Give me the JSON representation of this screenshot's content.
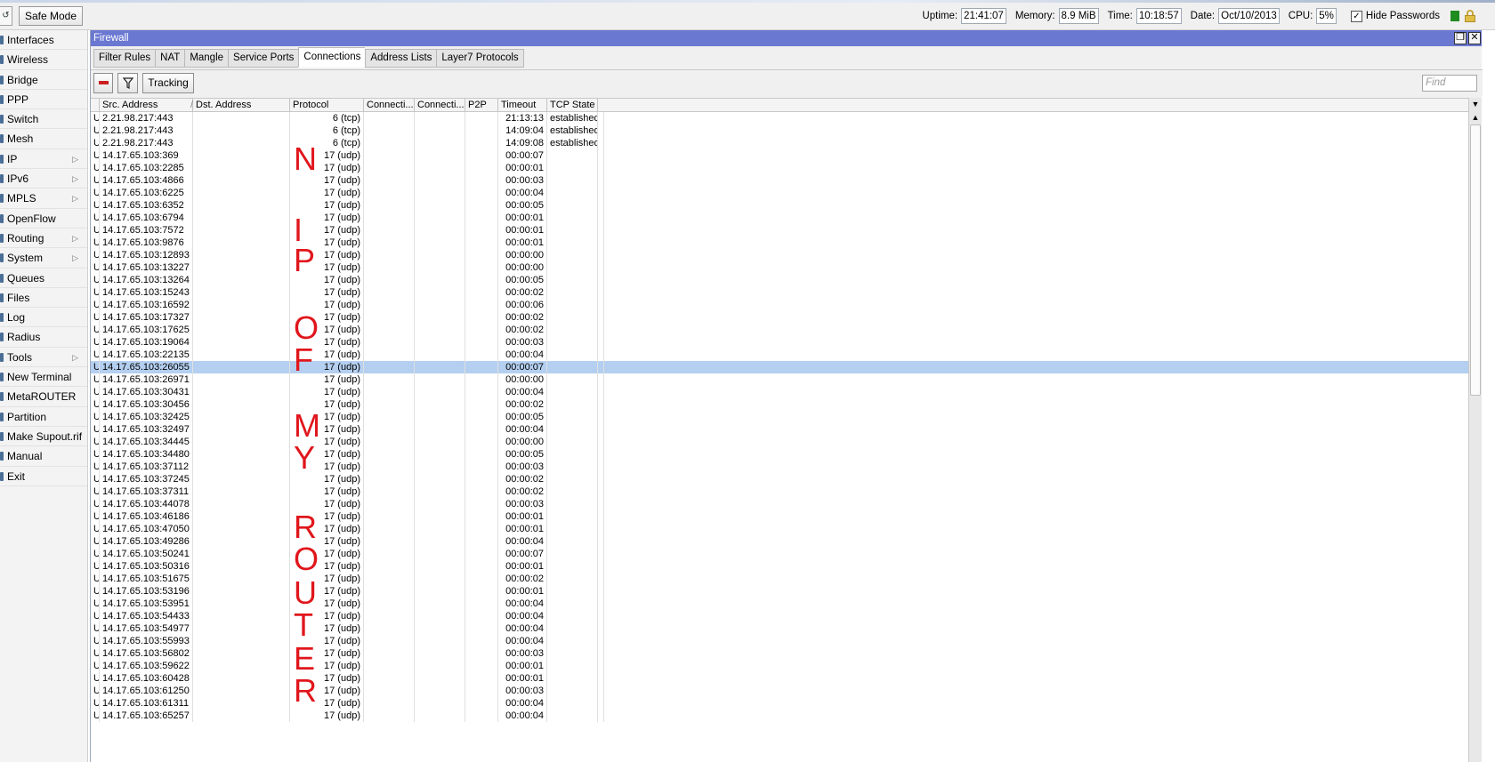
{
  "topbar": {
    "safe_mode_label": "Safe Mode",
    "uptime_label": "Uptime:",
    "uptime": "21:41:07",
    "memory_label": "Memory:",
    "memory": "8.9 MiB",
    "time_label": "Time:",
    "time": "10:18:57",
    "date_label": "Date:",
    "date": "Oct/10/2013",
    "cpu_label": "CPU:",
    "cpu": "5%",
    "hide_passwords_label": "Hide Passwords",
    "hide_passwords_checked": true
  },
  "sidebar": {
    "items": [
      {
        "label": "Interfaces",
        "submenu": false
      },
      {
        "label": "Wireless",
        "submenu": false
      },
      {
        "label": "Bridge",
        "submenu": false
      },
      {
        "label": "PPP",
        "submenu": false
      },
      {
        "label": "Switch",
        "submenu": false
      },
      {
        "label": "Mesh",
        "submenu": false
      },
      {
        "label": "IP",
        "submenu": true
      },
      {
        "label": "IPv6",
        "submenu": true
      },
      {
        "label": "MPLS",
        "submenu": true
      },
      {
        "label": "OpenFlow",
        "submenu": false
      },
      {
        "label": "Routing",
        "submenu": true
      },
      {
        "label": "System",
        "submenu": true
      },
      {
        "label": "Queues",
        "submenu": false
      },
      {
        "label": "Files",
        "submenu": false
      },
      {
        "label": "Log",
        "submenu": false
      },
      {
        "label": "Radius",
        "submenu": false
      },
      {
        "label": "Tools",
        "submenu": true
      },
      {
        "label": "New Terminal",
        "submenu": false
      },
      {
        "label": "MetaROUTER",
        "submenu": false
      },
      {
        "label": "Partition",
        "submenu": false
      },
      {
        "label": "Make Supout.rif",
        "submenu": false
      },
      {
        "label": "Manual",
        "submenu": false
      },
      {
        "label": "Exit",
        "submenu": false
      }
    ]
  },
  "window": {
    "title": "Firewall",
    "tabs": [
      "Filter Rules",
      "NAT",
      "Mangle",
      "Service Ports",
      "Connections",
      "Address Lists",
      "Layer7 Protocols"
    ],
    "active_tab": "Connections",
    "tracking_label": "Tracking",
    "find_placeholder": "Find"
  },
  "table": {
    "columns": [
      "",
      "Src. Address",
      "Dst. Address",
      "Protocol",
      "Connecti...",
      "Connecti...",
      "P2P",
      "Timeout",
      "TCP State"
    ],
    "sort_indicator": "/",
    "selected_row": 20,
    "rows": [
      [
        "U",
        "2.21.98.217:443",
        "",
        "6 (tcp)",
        "",
        "",
        "",
        "21:13:13",
        "established"
      ],
      [
        "U",
        "2.21.98.217:443",
        "",
        "6 (tcp)",
        "",
        "",
        "",
        "14:09:04",
        "established"
      ],
      [
        "U",
        "2.21.98.217:443",
        "",
        "6 (tcp)",
        "",
        "",
        "",
        "14:09:08",
        "established"
      ],
      [
        "U",
        "14.17.65.103:369",
        "",
        "17 (udp)",
        "",
        "",
        "",
        "00:00:07",
        ""
      ],
      [
        "U",
        "14.17.65.103:2285",
        "",
        "17 (udp)",
        "",
        "",
        "",
        "00:00:01",
        ""
      ],
      [
        "U",
        "14.17.65.103:4866",
        "",
        "17 (udp)",
        "",
        "",
        "",
        "00:00:03",
        ""
      ],
      [
        "U",
        "14.17.65.103:6225",
        "",
        "17 (udp)",
        "",
        "",
        "",
        "00:00:04",
        ""
      ],
      [
        "U",
        "14.17.65.103:6352",
        "",
        "17 (udp)",
        "",
        "",
        "",
        "00:00:05",
        ""
      ],
      [
        "U",
        "14.17.65.103:6794",
        "",
        "17 (udp)",
        "",
        "",
        "",
        "00:00:01",
        ""
      ],
      [
        "U",
        "14.17.65.103:7572",
        "",
        "17 (udp)",
        "",
        "",
        "",
        "00:00:01",
        ""
      ],
      [
        "U",
        "14.17.65.103:9876",
        "",
        "17 (udp)",
        "",
        "",
        "",
        "00:00:01",
        ""
      ],
      [
        "U",
        "14.17.65.103:12893",
        "",
        "17 (udp)",
        "",
        "",
        "",
        "00:00:00",
        ""
      ],
      [
        "U",
        "14.17.65.103:13227",
        "",
        "17 (udp)",
        "",
        "",
        "",
        "00:00:00",
        ""
      ],
      [
        "U",
        "14.17.65.103:13264",
        "",
        "17 (udp)",
        "",
        "",
        "",
        "00:00:05",
        ""
      ],
      [
        "U",
        "14.17.65.103:15243",
        "",
        "17 (udp)",
        "",
        "",
        "",
        "00:00:02",
        ""
      ],
      [
        "U",
        "14.17.65.103:16592",
        "",
        "17 (udp)",
        "",
        "",
        "",
        "00:00:06",
        ""
      ],
      [
        "U",
        "14.17.65.103:17327",
        "",
        "17 (udp)",
        "",
        "",
        "",
        "00:00:02",
        ""
      ],
      [
        "U",
        "14.17.65.103:17625",
        "",
        "17 (udp)",
        "",
        "",
        "",
        "00:00:02",
        ""
      ],
      [
        "U",
        "14.17.65.103:19064",
        "",
        "17 (udp)",
        "",
        "",
        "",
        "00:00:03",
        ""
      ],
      [
        "U",
        "14.17.65.103:22135",
        "",
        "17 (udp)",
        "",
        "",
        "",
        "00:00:04",
        ""
      ],
      [
        "U",
        "14.17.65.103:26055",
        "",
        "17 (udp)",
        "",
        "",
        "",
        "00:00:07",
        ""
      ],
      [
        "U",
        "14.17.65.103:26971",
        "",
        "17 (udp)",
        "",
        "",
        "",
        "00:00:00",
        ""
      ],
      [
        "U",
        "14.17.65.103:30431",
        "",
        "17 (udp)",
        "",
        "",
        "",
        "00:00:04",
        ""
      ],
      [
        "U",
        "14.17.65.103:30456",
        "",
        "17 (udp)",
        "",
        "",
        "",
        "00:00:02",
        ""
      ],
      [
        "U",
        "14.17.65.103:32425",
        "",
        "17 (udp)",
        "",
        "",
        "",
        "00:00:05",
        ""
      ],
      [
        "U",
        "14.17.65.103:32497",
        "",
        "17 (udp)",
        "",
        "",
        "",
        "00:00:04",
        ""
      ],
      [
        "U",
        "14.17.65.103:34445",
        "",
        "17 (udp)",
        "",
        "",
        "",
        "00:00:00",
        ""
      ],
      [
        "U",
        "14.17.65.103:34480",
        "",
        "17 (udp)",
        "",
        "",
        "",
        "00:00:05",
        ""
      ],
      [
        "U",
        "14.17.65.103:37112",
        "",
        "17 (udp)",
        "",
        "",
        "",
        "00:00:03",
        ""
      ],
      [
        "U",
        "14.17.65.103:37245",
        "",
        "17 (udp)",
        "",
        "",
        "",
        "00:00:02",
        ""
      ],
      [
        "U",
        "14.17.65.103:37311",
        "",
        "17 (udp)",
        "",
        "",
        "",
        "00:00:02",
        ""
      ],
      [
        "U",
        "14.17.65.103:44078",
        "",
        "17 (udp)",
        "",
        "",
        "",
        "00:00:03",
        ""
      ],
      [
        "U",
        "14.17.65.103:46186",
        "",
        "17 (udp)",
        "",
        "",
        "",
        "00:00:01",
        ""
      ],
      [
        "U",
        "14.17.65.103:47050",
        "",
        "17 (udp)",
        "",
        "",
        "",
        "00:00:01",
        ""
      ],
      [
        "U",
        "14.17.65.103:49286",
        "",
        "17 (udp)",
        "",
        "",
        "",
        "00:00:04",
        ""
      ],
      [
        "U",
        "14.17.65.103:50241",
        "",
        "17 (udp)",
        "",
        "",
        "",
        "00:00:07",
        ""
      ],
      [
        "U",
        "14.17.65.103:50316",
        "",
        "17 (udp)",
        "",
        "",
        "",
        "00:00:01",
        ""
      ],
      [
        "U",
        "14.17.65.103:51675",
        "",
        "17 (udp)",
        "",
        "",
        "",
        "00:00:02",
        ""
      ],
      [
        "U",
        "14.17.65.103:53196",
        "",
        "17 (udp)",
        "",
        "",
        "",
        "00:00:01",
        ""
      ],
      [
        "U",
        "14.17.65.103:53951",
        "",
        "17 (udp)",
        "",
        "",
        "",
        "00:00:04",
        ""
      ],
      [
        "U",
        "14.17.65.103:54433",
        "",
        "17 (udp)",
        "",
        "",
        "",
        "00:00:04",
        ""
      ],
      [
        "U",
        "14.17.65.103:54977",
        "",
        "17 (udp)",
        "",
        "",
        "",
        "00:00:04",
        ""
      ],
      [
        "U",
        "14.17.65.103:55993",
        "",
        "17 (udp)",
        "",
        "",
        "",
        "00:00:04",
        ""
      ],
      [
        "U",
        "14.17.65.103:56802",
        "",
        "17 (udp)",
        "",
        "",
        "",
        "00:00:03",
        ""
      ],
      [
        "U",
        "14.17.65.103:59622",
        "",
        "17 (udp)",
        "",
        "",
        "",
        "00:00:01",
        ""
      ],
      [
        "U",
        "14.17.65.103:60428",
        "",
        "17 (udp)",
        "",
        "",
        "",
        "00:00:01",
        ""
      ],
      [
        "U",
        "14.17.65.103:61250",
        "",
        "17 (udp)",
        "",
        "",
        "",
        "00:00:03",
        ""
      ],
      [
        "U",
        "14.17.65.103:61311",
        "",
        "17 (udp)",
        "",
        "",
        "",
        "00:00:04",
        ""
      ],
      [
        "U",
        "14.17.65.103:65257",
        "",
        "17 (udp)",
        "",
        "",
        "",
        "00:00:04",
        ""
      ]
    ]
  },
  "annotation": {
    "color": "#e0161c",
    "letters": [
      "N",
      "I",
      "P",
      "O",
      "F",
      "M",
      "Y",
      "R",
      "O",
      "U",
      "T",
      "E",
      "R"
    ]
  }
}
